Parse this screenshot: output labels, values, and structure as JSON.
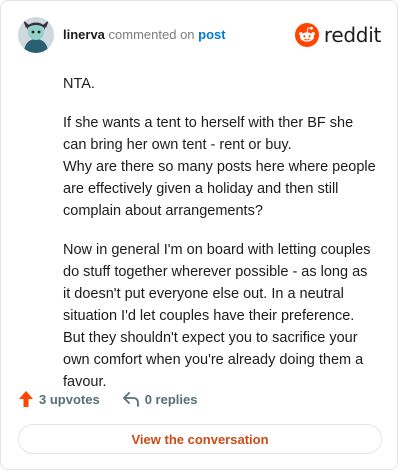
{
  "header": {
    "username": "linerva",
    "action_text": "commented on",
    "post_link": "post",
    "brand": "reddit"
  },
  "comment": {
    "p1": "NTA.",
    "p2_line1": "If she wants a tent to herself with ther BF she can bring her own tent - rent or buy.",
    "p2_line2": "Why are there so many posts here where people are effectively given a holiday and then still complain about arrangements?",
    "p3": "Now in general I'm on board with letting couples do stuff together wherever possible - as long as it doesn't put everyone else out. In a neutral situation I'd let couples have their preference. But they shouldn't expect you to sacrifice your own comfort when you're already doing them a favour."
  },
  "footer": {
    "upvotes": "3 upvotes",
    "replies": "0 replies",
    "view_button": "View the conversation"
  },
  "colors": {
    "brand": "#ff4500",
    "link": "#0079d3",
    "button_text": "#cc4a14"
  }
}
